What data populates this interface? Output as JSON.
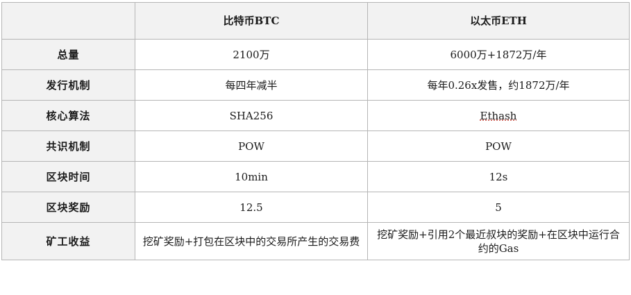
{
  "headers": {
    "corner": "",
    "btc": "比特币BTC",
    "eth": "以太币ETH"
  },
  "rows": [
    {
      "label": "总量",
      "btc": "2100万",
      "eth": "6000万+1872万/年"
    },
    {
      "label": "发行机制",
      "btc": "每四年减半",
      "eth": "每年0.26x发售，约1872万/年"
    },
    {
      "label": "核心算法",
      "btc": "SHA256",
      "eth": "Ethash"
    },
    {
      "label": "共识机制",
      "btc": "POW",
      "eth": "POW"
    },
    {
      "label": "区块时间",
      "btc": "10min",
      "eth": "12s"
    },
    {
      "label": "区块奖励",
      "btc": "12.5",
      "eth": "5"
    },
    {
      "label": "矿工收益",
      "btc": "挖矿奖励+打包在区块中的交易所产生的交易费",
      "eth": "挖矿奖励+引用2个最近叔块的奖励+在区块中运行合约的Gas"
    }
  ]
}
